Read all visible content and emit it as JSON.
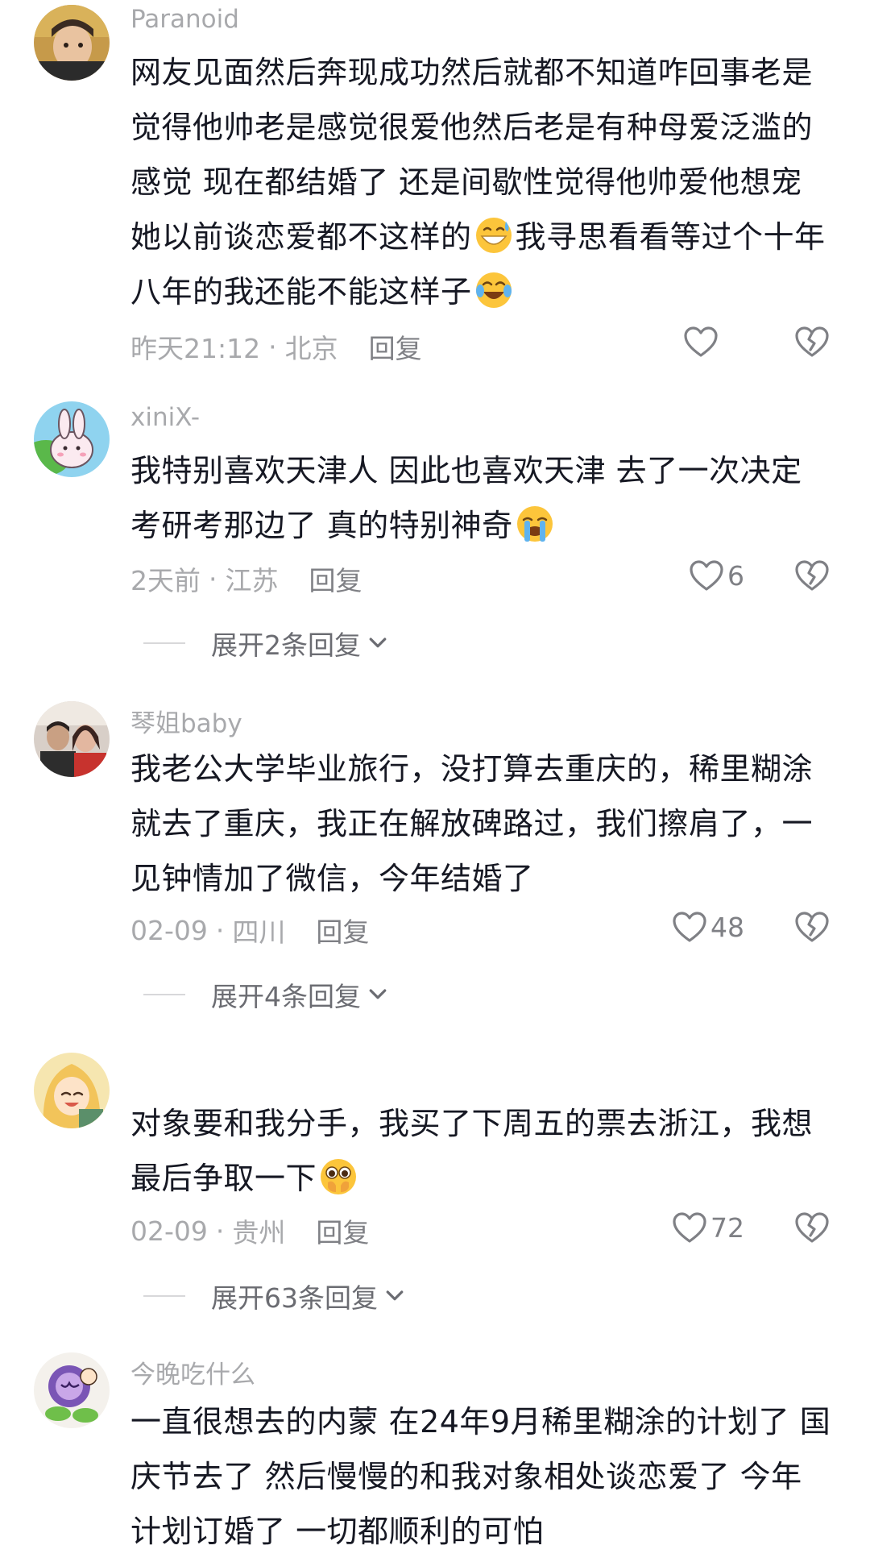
{
  "comments": [
    {
      "username": "Paranoid",
      "lines": [
        "网友见面然后奔现成功然后就都不知道咋回事老是",
        "觉得他帅老是感觉很爱他然后老是有种母爱泛滥的",
        "感觉  现在都结婚了 还是间歇性觉得他帅爱他想宠",
        "她以前谈恋爱都不这样的",
        "我寻思看看等过个十年",
        "八年的我还能不能这样子"
      ],
      "time": "昨天21:12",
      "location": "北京",
      "reply": "回复",
      "likes": ""
    },
    {
      "username": "xiniX-",
      "lines": [
        "我特别喜欢天津人  因此也喜欢天津  去了一次决定",
        "考研考那边了  真的特别神奇"
      ],
      "time": "2天前",
      "location": "江苏",
      "reply": "回复",
      "likes": "6",
      "expand": "展开2条回复"
    },
    {
      "username": "琴姐baby",
      "lines": [
        "我老公大学毕业旅行，没打算去重庆的，稀里糊涂",
        "就去了重庆，我正在解放碑路过，我们擦肩了，一",
        "见钟情加了微信，今年结婚了"
      ],
      "time": "02-09",
      "location": "四川",
      "reply": "回复",
      "likes": "48",
      "expand": "展开4条回复"
    },
    {
      "username": "",
      "lines": [
        "对象要和我分手，我买了下周五的票去浙江，我想",
        "最后争取一下"
      ],
      "time": "02-09",
      "location": "贵州",
      "reply": "回复",
      "likes": "72",
      "expand": "展开63条回复"
    },
    {
      "username": "今晚吃什么",
      "lines": [
        "一直很想去的内蒙 在24年9月稀里糊涂的计划了 国",
        "庆节去了 然后慢慢的和我对象相处谈恋爱了 今年",
        "计划订婚了 一切都顺利的可怕"
      ]
    }
  ],
  "meta_separator": "·",
  "icons": {
    "like": "heart-outline-icon",
    "dislike": "broken-heart-icon",
    "expand": "chevron-down-icon",
    "emoji_sweat": "grinning-sweat-emoji",
    "emoji_tears": "tears-of-joy-emoji",
    "emoji_cry": "loudly-crying-emoji",
    "emoji_plead": "pleading-hands-emoji"
  },
  "colors": {
    "text": "#161823",
    "muted": "#a8a9ac",
    "action": "#7f8085",
    "background": "#ffffff"
  }
}
